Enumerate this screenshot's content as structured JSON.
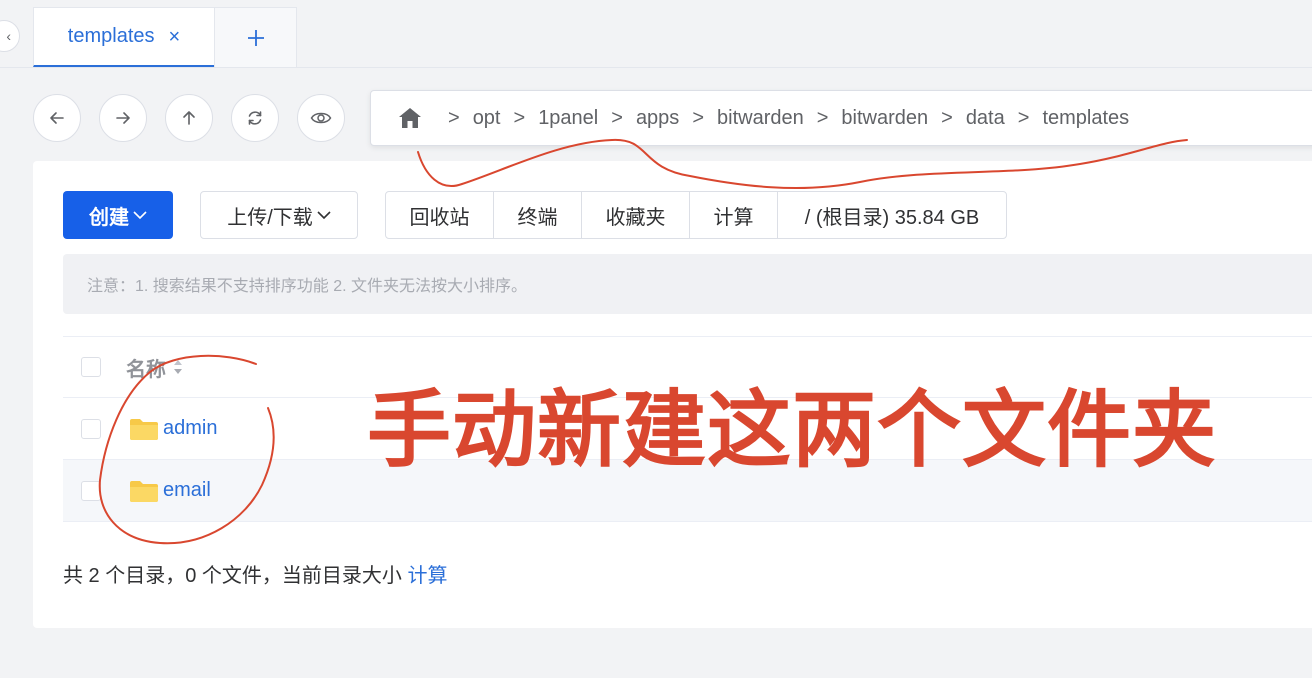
{
  "tabs": {
    "active_label": "templates",
    "close_glyph": "×",
    "add_glyph": "+"
  },
  "nav": {
    "back_icon": "arrow-left-icon",
    "forward_icon": "arrow-right-icon",
    "up_icon": "arrow-up-icon",
    "refresh_icon": "refresh-icon",
    "view_icon": "eye-icon"
  },
  "breadcrumb": {
    "home_icon": "home-icon",
    "separator": ">",
    "segments": [
      "opt",
      "1panel",
      "apps",
      "bitwarden",
      "bitwarden",
      "data",
      "templates"
    ]
  },
  "toolbar": {
    "create_label": "创建",
    "upload_label": "上传/下载",
    "group": [
      "回收站",
      "终端",
      "收藏夹",
      "计算",
      "/ (根目录) 35.84 GB"
    ]
  },
  "notice": "注意：1. 搜索结果不支持排序功能 2. 文件夹无法按大小排序。",
  "table": {
    "col_name": "名称",
    "rows": [
      {
        "name": "admin"
      },
      {
        "name": "email"
      }
    ]
  },
  "footer": {
    "summary": "共 2 个目录，0 个文件，当前目录大小",
    "calc_link": "计算"
  },
  "annotation": {
    "text": "手动新建这两个文件夹",
    "color": "#d9472f"
  },
  "colors": {
    "primary": "#1760e8",
    "link": "#2b6fd8",
    "folder": "#f7c948"
  }
}
